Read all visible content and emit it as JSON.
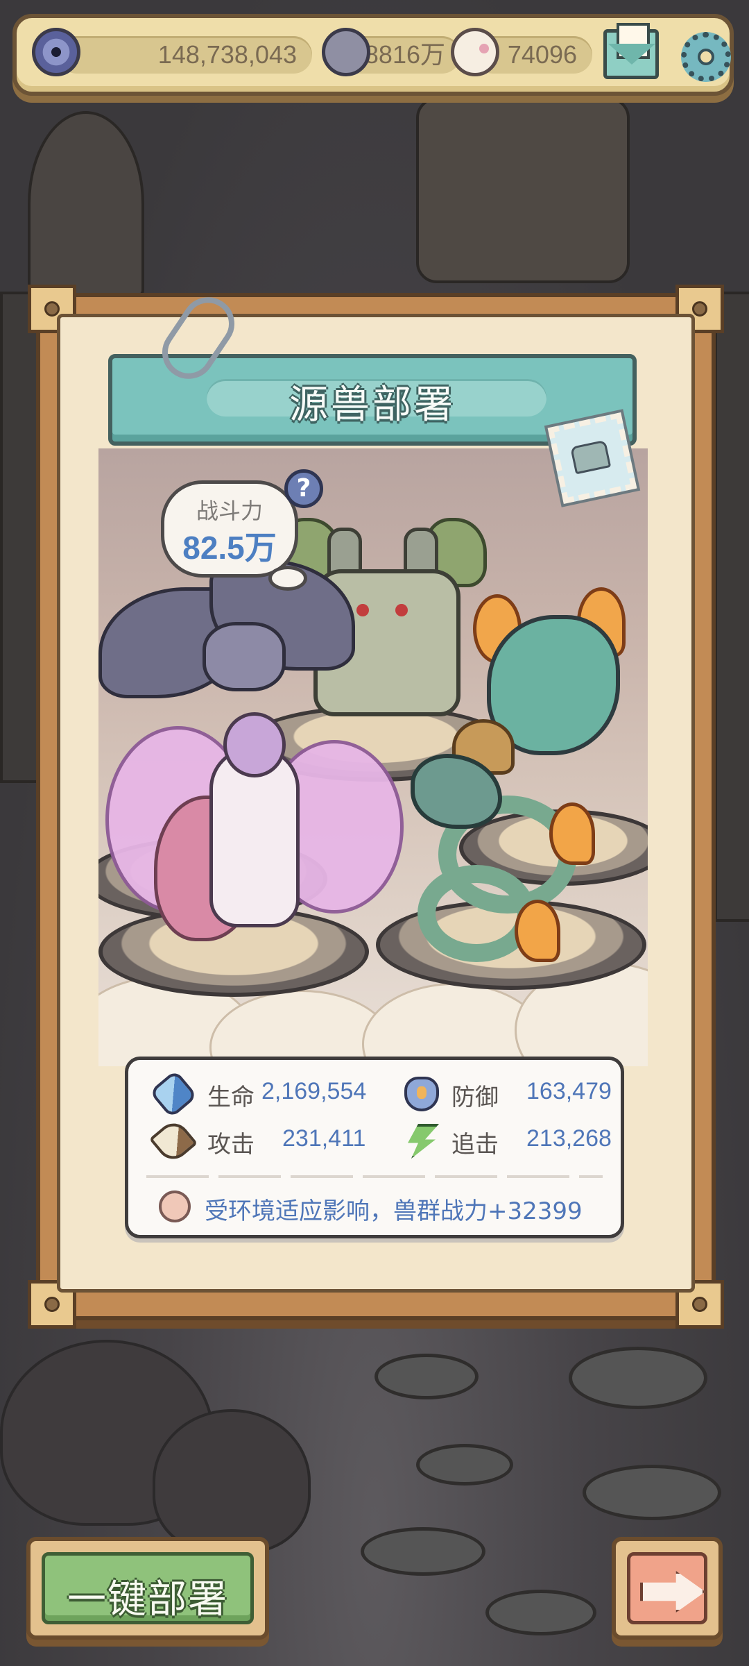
{
  "resources": {
    "coins": "148,738,043",
    "blob": "8816万",
    "ghost": "74096"
  },
  "panel": {
    "title": "源兽部署",
    "power_label": "战斗力",
    "power_value": "82.5万",
    "help": "?"
  },
  "stats": {
    "hp": {
      "label": "生命",
      "value": "2,169,554"
    },
    "defense": {
      "label": "防御",
      "value": "163,479"
    },
    "attack": {
      "label": "攻击",
      "value": "231,411"
    },
    "chase": {
      "label": "追击",
      "value": "213,268"
    },
    "env_note": "受环境适应影响，兽群战力+32399"
  },
  "buttons": {
    "deploy": "一键部署"
  },
  "icons": [
    "eye-icon",
    "blob-icon",
    "ghost-icon",
    "mail-icon",
    "gear-icon",
    "help-icon",
    "stamp-icon",
    "hp-icon",
    "defense-icon",
    "attack-icon",
    "chase-icon",
    "arrow-right-icon"
  ]
}
